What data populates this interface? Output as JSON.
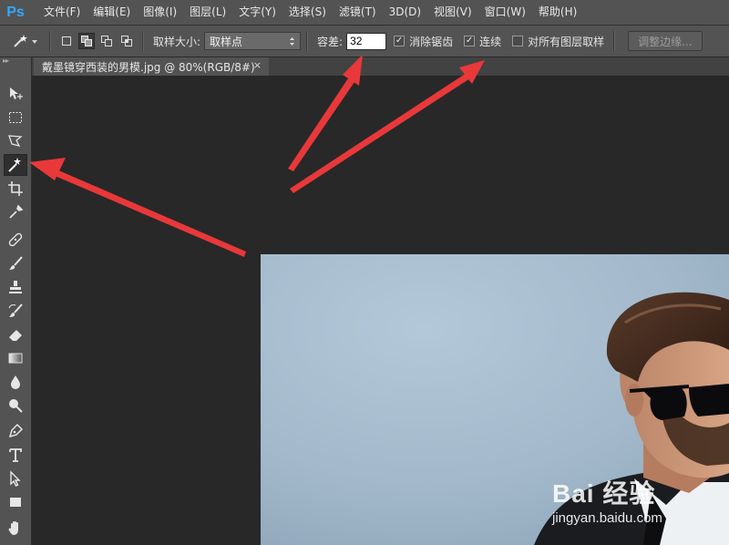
{
  "app": {
    "logo": "Ps"
  },
  "menu": [
    "文件(F)",
    "编辑(E)",
    "图像(I)",
    "图层(L)",
    "文字(Y)",
    "选择(S)",
    "滤镜(T)",
    "3D(D)",
    "视图(V)",
    "窗口(W)",
    "帮助(H)"
  ],
  "options": {
    "sample_size_label": "取样大小:",
    "sample_size_value": "取样点",
    "tolerance_label": "容差:",
    "tolerance_value": "32",
    "anti_alias_label": "消除锯齿",
    "anti_alias_checked": true,
    "contiguous_label": "连续",
    "contiguous_checked": true,
    "sample_all_layers_label": "对所有图层取样",
    "sample_all_layers_checked": false,
    "refine_edge_label": "调整边缘..."
  },
  "tools": [
    "move-tool-icon",
    "rectangular-marquee-icon",
    "polygonal-lasso-icon",
    "magic-wand-icon",
    "crop-icon",
    "eyedropper-icon",
    "healing-brush-icon",
    "brush-icon",
    "clone-stamp-icon",
    "history-brush-icon",
    "eraser-icon",
    "gradient-icon",
    "blur-icon",
    "dodge-icon",
    "pen-icon",
    "type-icon",
    "path-selection-icon",
    "rectangle-shape-icon",
    "hand-icon"
  ],
  "active_tool": "magic-wand-icon",
  "document": {
    "tab_title": "戴墨镜穿西装的男模.jpg @ 80%(RGB/8#)",
    "close_glyph": "×"
  },
  "watermark": {
    "brand": "Bai 经验",
    "url": "jingyan.baidu.com"
  },
  "colors": {
    "ui_panel": "#535353",
    "canvas_bg": "#282828",
    "annotation_arrow": "#e8383a",
    "photo_background": "#a9bfd1"
  }
}
